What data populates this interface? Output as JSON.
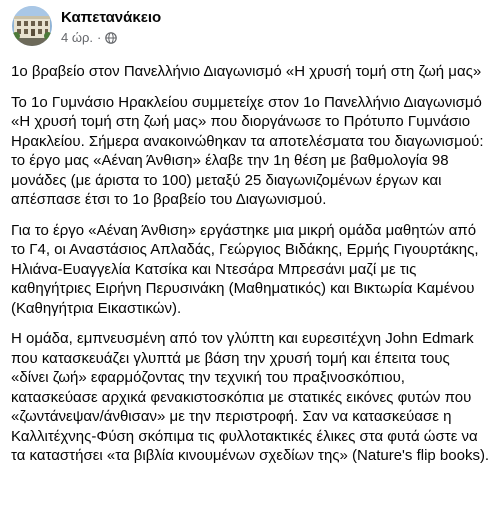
{
  "post": {
    "page_name": "Καπετανάκειο",
    "timestamp": "4 ώρ.",
    "separator": "·",
    "privacy_icon": "globe-icon",
    "avatar_icon": "school-building-photo",
    "paragraphs": [
      "1ο βραβείο στον Πανελλήνιο Διαγωνισμό «Η χρυσή τομή στη ζωή μας»",
      "Το 1ο Γυμνάσιο Ηρακλείου συμμετείχε στον 1ο Πανελλήνιο Διαγωνισμό «Η χρυσή τομή στη ζωή μας» που διοργάνωσε το Πρότυπο Γυμνάσιο Ηρακλείου. Σήμερα ανακοινώθηκαν τα αποτελέσματα του διαγωνισμού: το έργο μας «Αέναη Άνθιση» έλαβε την 1η θέση με βαθμολογία 98 μονάδες (με άριστα το 100) μεταξύ 25 διαγωνιζομένων έργων και απέσπασε έτσι το 1ο βραβείο του Διαγωνισμού.",
      "Για το έργο «Αέναη Άνθιση» εργάστηκε μια μικρή ομάδα μαθητών από το Γ4, οι Αναστάσιος Απλαδάς, Γεώργιος Βιδάκης, Ερμής Γιγουρτάκης, Ηλιάνα-Ευαγγελία Κατσίκα και Ντεσάρα Μπρεσάνι μαζί με τις καθηγήτριες Ειρήνη Περυσινάκη (Μαθηματικός) και Βικτωρία Καμένου (Καθηγήτρια Εικαστικών).",
      "Η ομάδα, εμπνευσμένη από τον γλύπτη και ευρεσιτέχνη John Edmark που κατασκευάζει γλυπτά με βάση την χρυσή τομή και έπειτα τους «δίνει ζωή» εφαρμόζοντας την τεχνική του πραξινοσκόπιου, κατασκεύασε αρχικά φενακιστοσκόπια με στατικές εικόνες φυτών που «ζωντάνεψαν/άνθισαν» με την περιστροφή. Σαν να κατασκεύασε η Καλλιτέχνης-Φύση σκόπιμα τις φυλλοτακτικές έλικες στα φυτά ώστε να τα καταστήσει «τα βιβλία κινουμένων σχεδίων της» (Nature's flip books)."
    ]
  }
}
